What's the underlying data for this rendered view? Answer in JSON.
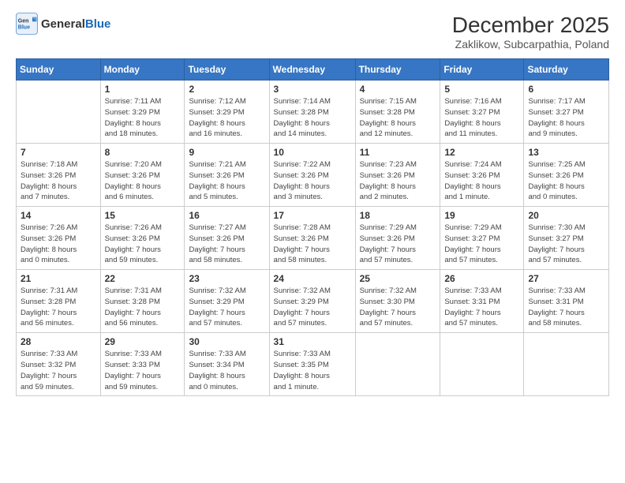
{
  "logo": {
    "general": "General",
    "blue": "Blue"
  },
  "title": "December 2025",
  "subtitle": "Zaklikow, Subcarpathia, Poland",
  "days_of_week": [
    "Sunday",
    "Monday",
    "Tuesday",
    "Wednesday",
    "Thursday",
    "Friday",
    "Saturday"
  ],
  "weeks": [
    [
      {
        "day": "",
        "info": ""
      },
      {
        "day": "1",
        "info": "Sunrise: 7:11 AM\nSunset: 3:29 PM\nDaylight: 8 hours\nand 18 minutes."
      },
      {
        "day": "2",
        "info": "Sunrise: 7:12 AM\nSunset: 3:29 PM\nDaylight: 8 hours\nand 16 minutes."
      },
      {
        "day": "3",
        "info": "Sunrise: 7:14 AM\nSunset: 3:28 PM\nDaylight: 8 hours\nand 14 minutes."
      },
      {
        "day": "4",
        "info": "Sunrise: 7:15 AM\nSunset: 3:28 PM\nDaylight: 8 hours\nand 12 minutes."
      },
      {
        "day": "5",
        "info": "Sunrise: 7:16 AM\nSunset: 3:27 PM\nDaylight: 8 hours\nand 11 minutes."
      },
      {
        "day": "6",
        "info": "Sunrise: 7:17 AM\nSunset: 3:27 PM\nDaylight: 8 hours\nand 9 minutes."
      }
    ],
    [
      {
        "day": "7",
        "info": "Sunrise: 7:18 AM\nSunset: 3:26 PM\nDaylight: 8 hours\nand 7 minutes."
      },
      {
        "day": "8",
        "info": "Sunrise: 7:20 AM\nSunset: 3:26 PM\nDaylight: 8 hours\nand 6 minutes."
      },
      {
        "day": "9",
        "info": "Sunrise: 7:21 AM\nSunset: 3:26 PM\nDaylight: 8 hours\nand 5 minutes."
      },
      {
        "day": "10",
        "info": "Sunrise: 7:22 AM\nSunset: 3:26 PM\nDaylight: 8 hours\nand 3 minutes."
      },
      {
        "day": "11",
        "info": "Sunrise: 7:23 AM\nSunset: 3:26 PM\nDaylight: 8 hours\nand 2 minutes."
      },
      {
        "day": "12",
        "info": "Sunrise: 7:24 AM\nSunset: 3:26 PM\nDaylight: 8 hours\nand 1 minute."
      },
      {
        "day": "13",
        "info": "Sunrise: 7:25 AM\nSunset: 3:26 PM\nDaylight: 8 hours\nand 0 minutes."
      }
    ],
    [
      {
        "day": "14",
        "info": "Sunrise: 7:26 AM\nSunset: 3:26 PM\nDaylight: 8 hours\nand 0 minutes."
      },
      {
        "day": "15",
        "info": "Sunrise: 7:26 AM\nSunset: 3:26 PM\nDaylight: 7 hours\nand 59 minutes."
      },
      {
        "day": "16",
        "info": "Sunrise: 7:27 AM\nSunset: 3:26 PM\nDaylight: 7 hours\nand 58 minutes."
      },
      {
        "day": "17",
        "info": "Sunrise: 7:28 AM\nSunset: 3:26 PM\nDaylight: 7 hours\nand 58 minutes."
      },
      {
        "day": "18",
        "info": "Sunrise: 7:29 AM\nSunset: 3:26 PM\nDaylight: 7 hours\nand 57 minutes."
      },
      {
        "day": "19",
        "info": "Sunrise: 7:29 AM\nSunset: 3:27 PM\nDaylight: 7 hours\nand 57 minutes."
      },
      {
        "day": "20",
        "info": "Sunrise: 7:30 AM\nSunset: 3:27 PM\nDaylight: 7 hours\nand 57 minutes."
      }
    ],
    [
      {
        "day": "21",
        "info": "Sunrise: 7:31 AM\nSunset: 3:28 PM\nDaylight: 7 hours\nand 56 minutes."
      },
      {
        "day": "22",
        "info": "Sunrise: 7:31 AM\nSunset: 3:28 PM\nDaylight: 7 hours\nand 56 minutes."
      },
      {
        "day": "23",
        "info": "Sunrise: 7:32 AM\nSunset: 3:29 PM\nDaylight: 7 hours\nand 57 minutes."
      },
      {
        "day": "24",
        "info": "Sunrise: 7:32 AM\nSunset: 3:29 PM\nDaylight: 7 hours\nand 57 minutes."
      },
      {
        "day": "25",
        "info": "Sunrise: 7:32 AM\nSunset: 3:30 PM\nDaylight: 7 hours\nand 57 minutes."
      },
      {
        "day": "26",
        "info": "Sunrise: 7:33 AM\nSunset: 3:31 PM\nDaylight: 7 hours\nand 57 minutes."
      },
      {
        "day": "27",
        "info": "Sunrise: 7:33 AM\nSunset: 3:31 PM\nDaylight: 7 hours\nand 58 minutes."
      }
    ],
    [
      {
        "day": "28",
        "info": "Sunrise: 7:33 AM\nSunset: 3:32 PM\nDaylight: 7 hours\nand 59 minutes."
      },
      {
        "day": "29",
        "info": "Sunrise: 7:33 AM\nSunset: 3:33 PM\nDaylight: 7 hours\nand 59 minutes."
      },
      {
        "day": "30",
        "info": "Sunrise: 7:33 AM\nSunset: 3:34 PM\nDaylight: 8 hours\nand 0 minutes."
      },
      {
        "day": "31",
        "info": "Sunrise: 7:33 AM\nSunset: 3:35 PM\nDaylight: 8 hours\nand 1 minute."
      },
      {
        "day": "",
        "info": ""
      },
      {
        "day": "",
        "info": ""
      },
      {
        "day": "",
        "info": ""
      }
    ]
  ]
}
